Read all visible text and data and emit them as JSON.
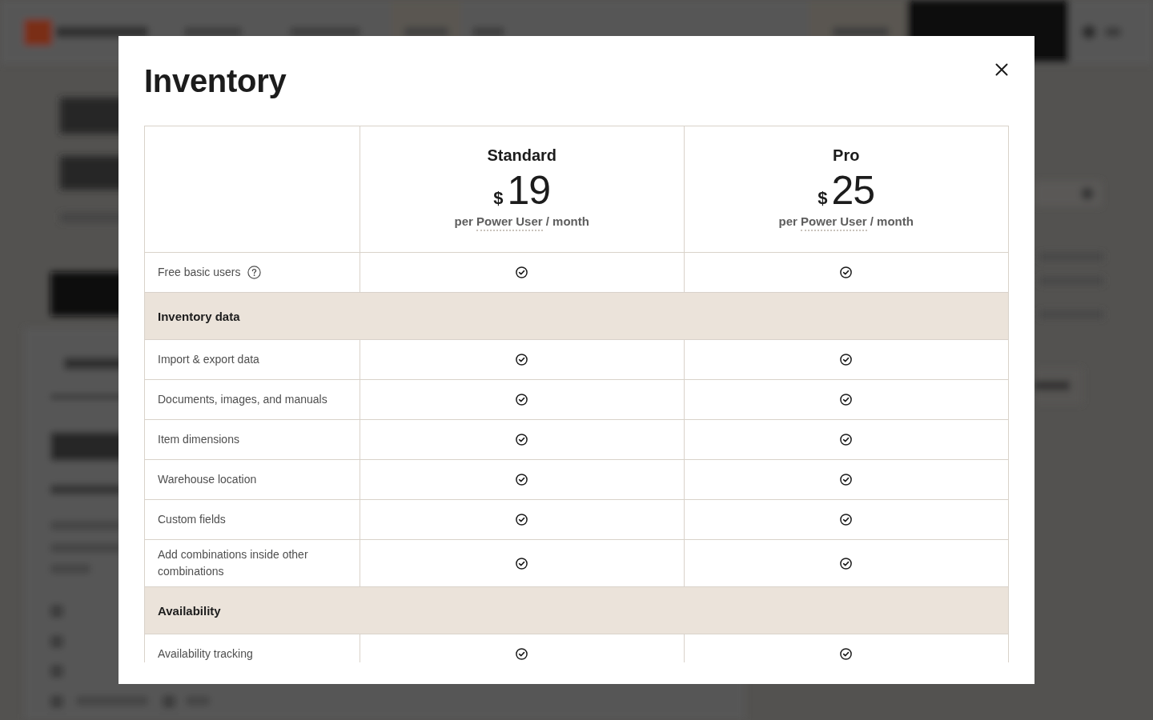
{
  "dialog": {
    "title": "Inventory"
  },
  "plans": [
    {
      "name": "Standard",
      "currency": "$",
      "price": "19",
      "unit_before": "per",
      "unit_term": "Power User",
      "unit_after": "/ month"
    },
    {
      "name": "Pro",
      "currency": "$",
      "price": "25",
      "unit_before": "per",
      "unit_term": "Power User",
      "unit_after": "/ month"
    }
  ],
  "rows": [
    {
      "kind": "feature",
      "label": "Free basic users",
      "help": true,
      "included": [
        true,
        true
      ]
    },
    {
      "kind": "section",
      "label": "Inventory data"
    },
    {
      "kind": "feature",
      "label": "Import & export data",
      "help": false,
      "included": [
        true,
        true
      ]
    },
    {
      "kind": "feature",
      "label": "Documents, images, and manuals",
      "help": false,
      "included": [
        true,
        true
      ]
    },
    {
      "kind": "feature",
      "label": "Item dimensions",
      "help": false,
      "included": [
        true,
        true
      ]
    },
    {
      "kind": "feature",
      "label": "Warehouse location",
      "help": false,
      "included": [
        true,
        true
      ]
    },
    {
      "kind": "feature",
      "label": "Custom fields",
      "help": false,
      "included": [
        true,
        true
      ]
    },
    {
      "kind": "feature",
      "label": "Add combinations inside other combinations",
      "help": false,
      "included": [
        true,
        true
      ]
    },
    {
      "kind": "section",
      "label": "Availability"
    },
    {
      "kind": "feature",
      "label": "Availability tracking",
      "help": false,
      "included": [
        true,
        true
      ]
    }
  ]
}
